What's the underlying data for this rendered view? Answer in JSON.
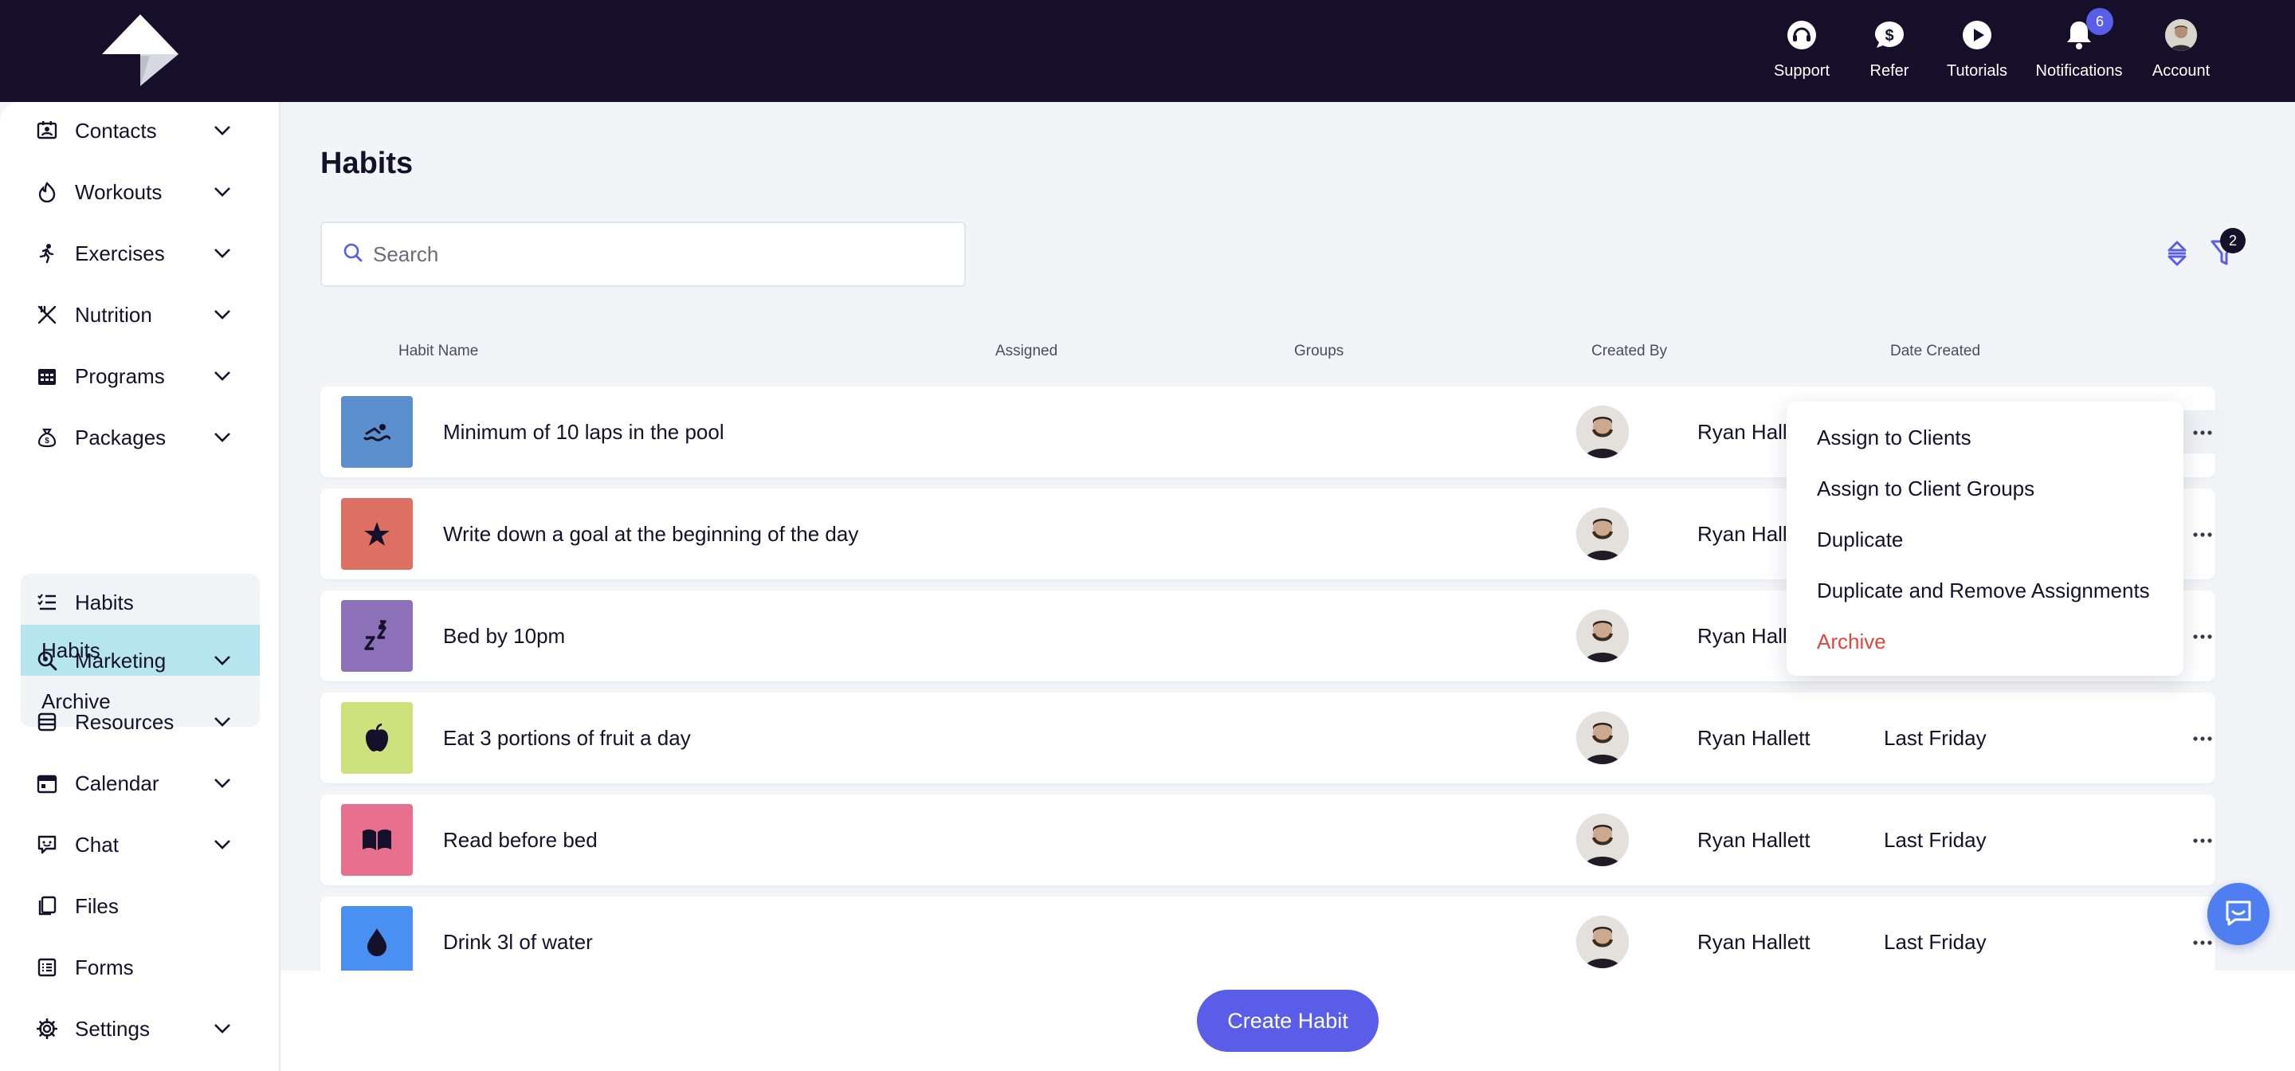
{
  "topbar": {
    "items": [
      {
        "label": "Support",
        "icon": "support-headset-icon"
      },
      {
        "label": "Refer",
        "icon": "dollar-chat-icon"
      },
      {
        "label": "Tutorials",
        "icon": "play-circle-icon"
      },
      {
        "label": "Notifications",
        "icon": "bell-icon",
        "badge": "6"
      },
      {
        "label": "Account",
        "icon": "avatar"
      }
    ]
  },
  "sidebar": {
    "items": [
      {
        "label": "Contacts",
        "icon": "contacts-icon"
      },
      {
        "label": "Workouts",
        "icon": "workouts-icon"
      },
      {
        "label": "Exercises",
        "icon": "running-icon"
      },
      {
        "label": "Nutrition",
        "icon": "utensils-icon"
      },
      {
        "label": "Programs",
        "icon": "calendar-grid-icon"
      },
      {
        "label": "Packages",
        "icon": "money-bag-icon"
      },
      {
        "label": "Habits",
        "icon": "list-check-icon"
      },
      {
        "label": "Marketing",
        "icon": "magnify-icon"
      },
      {
        "label": "Resources",
        "icon": "database-icon"
      },
      {
        "label": "Calendar",
        "icon": "calendar-icon"
      },
      {
        "label": "Chat",
        "icon": "chat-icon"
      },
      {
        "label": "Files",
        "icon": "files-icon"
      },
      {
        "label": "Forms",
        "icon": "forms-icon"
      },
      {
        "label": "Settings",
        "icon": "gear-icon"
      }
    ],
    "habits_sub": [
      {
        "label": "Habits",
        "active": true
      },
      {
        "label": "Archive",
        "active": false
      }
    ]
  },
  "main": {
    "title": "Habits",
    "search_placeholder": "Search",
    "filter_count": "2",
    "columns": [
      "Habit Name",
      "Assigned",
      "Groups",
      "Created By",
      "Date Created"
    ],
    "rows": [
      {
        "name": "Minimum of 10 laps in the pool",
        "icon": "swimmer-icon",
        "color": "#5b8fcd",
        "created_by": "Ryan Hallett",
        "date": ""
      },
      {
        "name": "Write down a goal at the beginning of the day",
        "icon": "star-icon",
        "color": "#dd6f63",
        "created_by": "Ryan Hallett",
        "date": ""
      },
      {
        "name": "Bed by 10pm",
        "icon": "sleep-zzz-icon",
        "color": "#8d71b8",
        "created_by": "Ryan Hallett",
        "date": ""
      },
      {
        "name": "Eat 3 portions of fruit a day",
        "icon": "apple-icon",
        "color": "#cde27c",
        "created_by": "Ryan Hallett",
        "date": "Last Friday"
      },
      {
        "name": "Read before bed",
        "icon": "book-icon",
        "color": "#e8708f",
        "created_by": "Ryan Hallett",
        "date": "Last Friday"
      },
      {
        "name": "Drink 3l of water",
        "icon": "water-drop-icon",
        "color": "#4a8ff2",
        "created_by": "Ryan Hallett",
        "date": "Last Friday"
      }
    ]
  },
  "context_menu": {
    "items": [
      "Assign to Clients",
      "Assign to Client Groups",
      "Duplicate",
      "Duplicate and Remove Assignments",
      "Archive"
    ]
  },
  "create_button": "Create Habit",
  "colors": {
    "topbar": "#150f29",
    "accent": "#5a5de8",
    "active_sub": "#b5e6ef",
    "danger": "#e0463d"
  }
}
